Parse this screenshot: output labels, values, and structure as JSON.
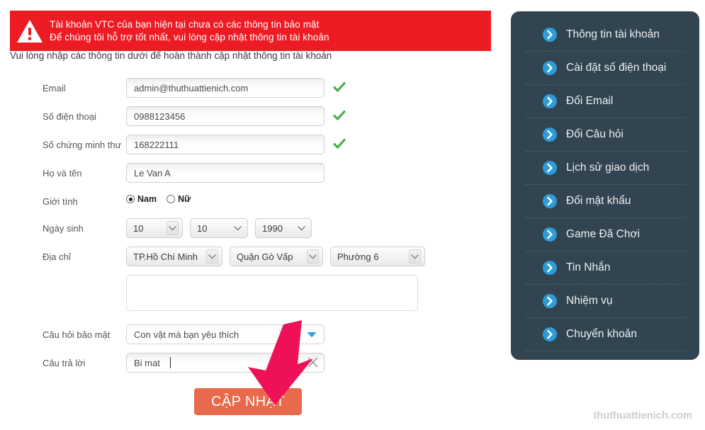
{
  "alert": {
    "icon": "warning-triangle-icon",
    "line1": "Tài khoản VTC của bạn hiện tại chưa có các thông tin bảo mật",
    "line2": "Để chúng tôi hỗ trợ tốt nhất, vui lòng cập nhật thông tin tài khoản",
    "bg_color": "#ed1c24"
  },
  "intro": {
    "text": "Vui lòng nhập các thông tin dưới để hoàn thành cập nhật thông tin tài khoản"
  },
  "form": {
    "email": {
      "label": "Email",
      "value": "admin@thuthuattienich.com",
      "verified": true
    },
    "phone": {
      "label": "Số điện thoại",
      "value": "0988123456",
      "verified": true
    },
    "id_number": {
      "label": "Số chứng minh thư",
      "value": "168222111",
      "verified": true
    },
    "full_name": {
      "label": "Họ và tên",
      "value": "Le Van A",
      "verified": false
    },
    "gender": {
      "label": "Giới tính",
      "options": [
        {
          "label": "Nam",
          "selected": true
        },
        {
          "label": "Nữ",
          "selected": false
        }
      ]
    },
    "dob": {
      "label": "Ngày sinh",
      "day": "10",
      "month": "10",
      "year": "1990"
    },
    "address": {
      "label": "Địa chỉ",
      "province": "TP.Hồ Chí Minh",
      "district": "Quận Gò Vấp",
      "ward": "Phường 6",
      "detail": "",
      "detail_placeholder": ""
    },
    "security_question": {
      "label": "Câu hỏi bảo mật",
      "value": "Con vật mà bạn yêu thích"
    },
    "security_answer": {
      "label": "Câu trả lời",
      "value": "Bi mat",
      "clear_icon": "close-x-icon"
    }
  },
  "submit": {
    "label": "CẬP NHẬT",
    "color": "#e8694b"
  },
  "sidebar": {
    "bg_color": "#32444f",
    "accent_color": "#2d9cd8",
    "items": [
      {
        "label": "Thông tin tài khoản",
        "icon": "chevron-right-circle-icon"
      },
      {
        "label": "Cài đặt số điện thoại",
        "icon": "chevron-right-circle-icon"
      },
      {
        "label": "Đổi Email",
        "icon": "chevron-right-circle-icon"
      },
      {
        "label": "Đổi Câu hỏi",
        "icon": "chevron-right-circle-icon"
      },
      {
        "label": "Lịch sử giao dịch",
        "icon": "chevron-right-circle-icon"
      },
      {
        "label": "Đổi mật khẩu",
        "icon": "chevron-right-circle-icon"
      },
      {
        "label": "Game Đã Chơi",
        "icon": "chevron-right-circle-icon"
      },
      {
        "label": "Tin Nhắn",
        "icon": "chevron-right-circle-icon"
      },
      {
        "label": "Nhiệm vụ",
        "icon": "chevron-right-circle-icon"
      },
      {
        "label": "Chuyển khoản",
        "icon": "chevron-right-circle-icon"
      }
    ]
  },
  "annotation": {
    "arrow_color": "#ee1157",
    "points_to": "CẬP NHẬT"
  },
  "watermark": {
    "text": "thuthuattienich.com"
  }
}
